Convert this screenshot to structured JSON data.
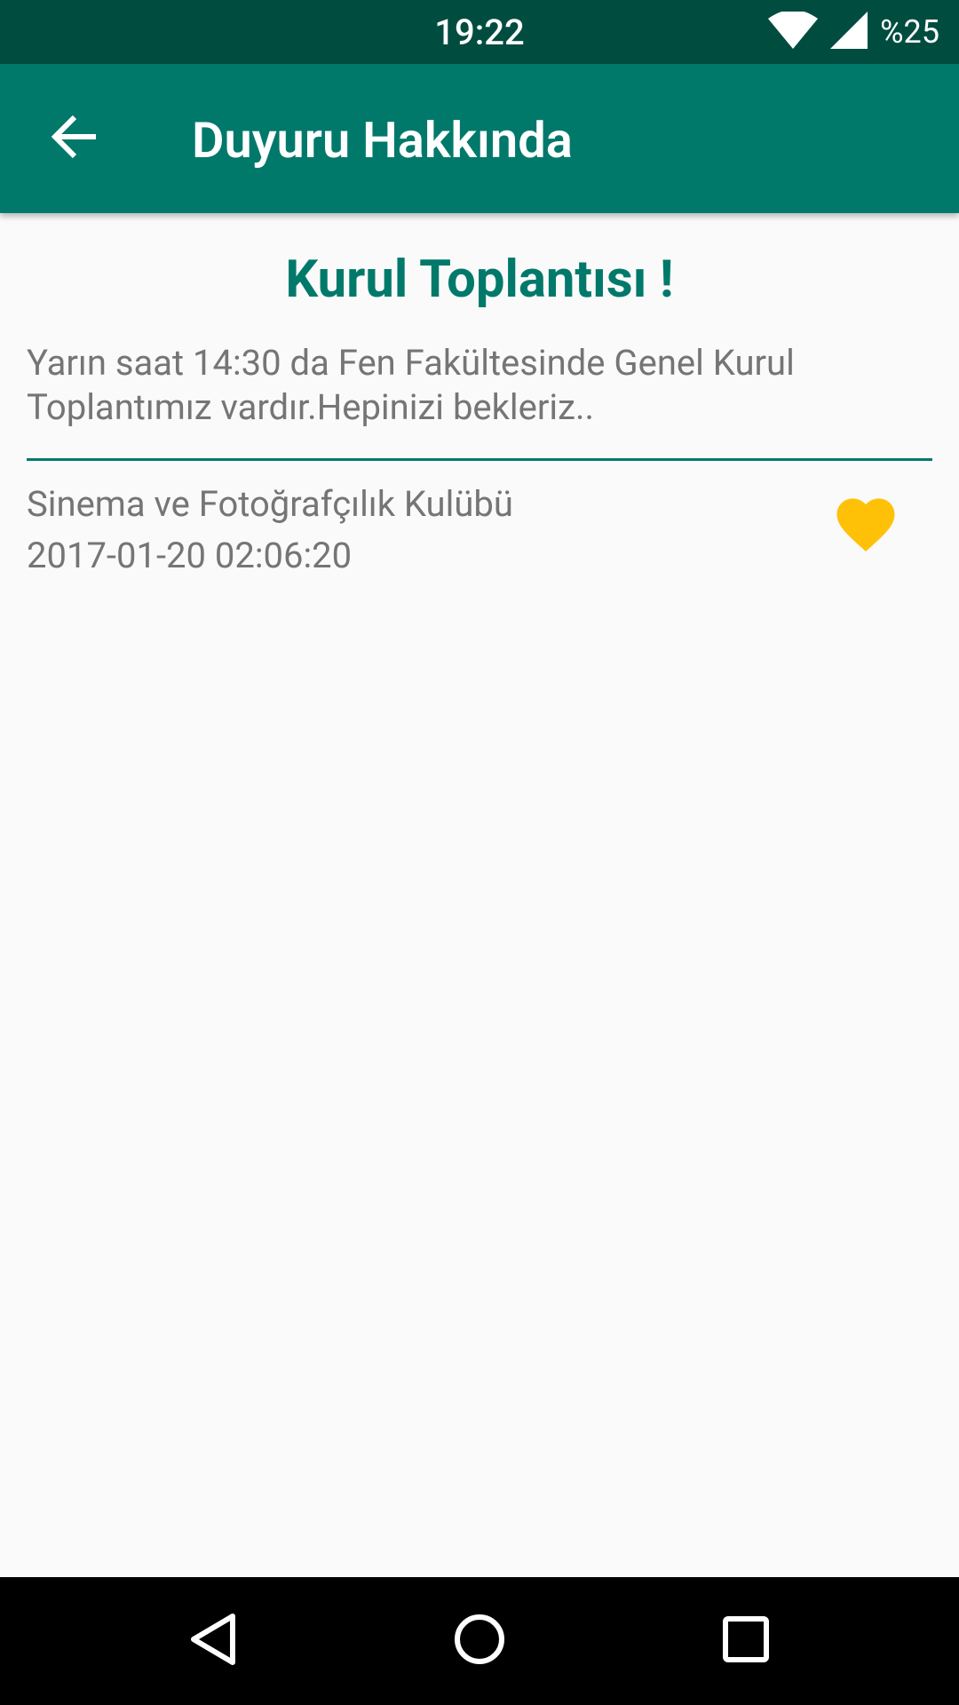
{
  "status_bar": {
    "time": "19:22",
    "battery": "%25",
    "icons": [
      "wifi-icon",
      "cell-signal-icon"
    ]
  },
  "app_bar": {
    "title": "Duyuru Hakkında",
    "back_icon": "arrow-back-icon"
  },
  "notice": {
    "title": "Kurul Toplantısı !",
    "body": "Yarın saat 14:30 da Fen Fakültesinde Genel Kurul Toplantımız vardır.Hepinizi bekleriz..",
    "club": "Sinema ve Fotoğrafçılık Kulübü",
    "date": "2017-01-20 02:06:20",
    "favorite_icon": "heart-icon",
    "favorite_color": "#ffc107"
  },
  "nav_bar": {
    "buttons": [
      "nav-back-icon",
      "nav-home-icon",
      "nav-recents-icon"
    ]
  },
  "colors": {
    "primary": "#00796b",
    "primary_dark": "#004d40",
    "background": "#fafafa",
    "text_secondary": "#757575"
  }
}
